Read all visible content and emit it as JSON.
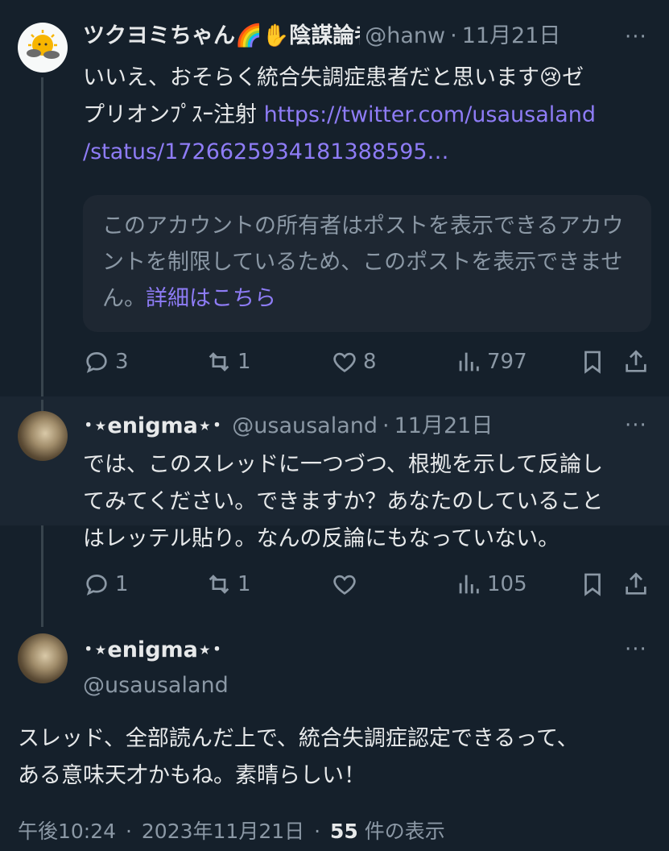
{
  "post1": {
    "display_name": "ツクヨミちゃん",
    "emoji_rainbow": "🌈",
    "emoji_hand": "✋",
    "name_suffix": "陰謀論者",
    "handle": "@hanw",
    "separator": "·",
    "date": "11月21日",
    "more": "···",
    "text_line1": "いいえ、おそらく統合失調症患者だと思います",
    "emoji_sad": "😢",
    "text_line1_tail": "ゼ",
    "text_line2": "プリオンﾌﾟｽｰ注射 ",
    "link_part1": "https://twitter.com/usausaland",
    "link_part2": "/status/1726625934181388595…",
    "notice_text": "このアカウントの所有者はポストを表示できるアカウントを制限しているため、このポストを表示できません。",
    "notice_link": "詳細はこちら",
    "replies": "3",
    "reposts": "1",
    "likes": "8",
    "views": "797"
  },
  "post2": {
    "display_name": "･⋆enigma⋆･",
    "handle": "@usausaland",
    "separator": "·",
    "date": "11月21日",
    "more": "···",
    "text_line1": "では、このスレッドに一つづつ、根拠を示して反論し",
    "text_line2": "てみてください。できますか？あなたのしていること",
    "text_line3": "はレッテル貼り。なんの反論にもなっていない。",
    "replies": "1",
    "reposts": "1",
    "likes": "",
    "views": "105"
  },
  "main_post": {
    "display_name": "･⋆enigma⋆･",
    "handle": "@usausaland",
    "more": "···",
    "text_line1": "スレッド、全部読んだ上で、統合失調症認定できるって、",
    "text_line2": "ある意味天才かもね。素晴らしい！",
    "time": "午後10:24",
    "separator": "·",
    "date": "2023年11月21日",
    "views_count": "55",
    "views_label": " 件の表示"
  }
}
